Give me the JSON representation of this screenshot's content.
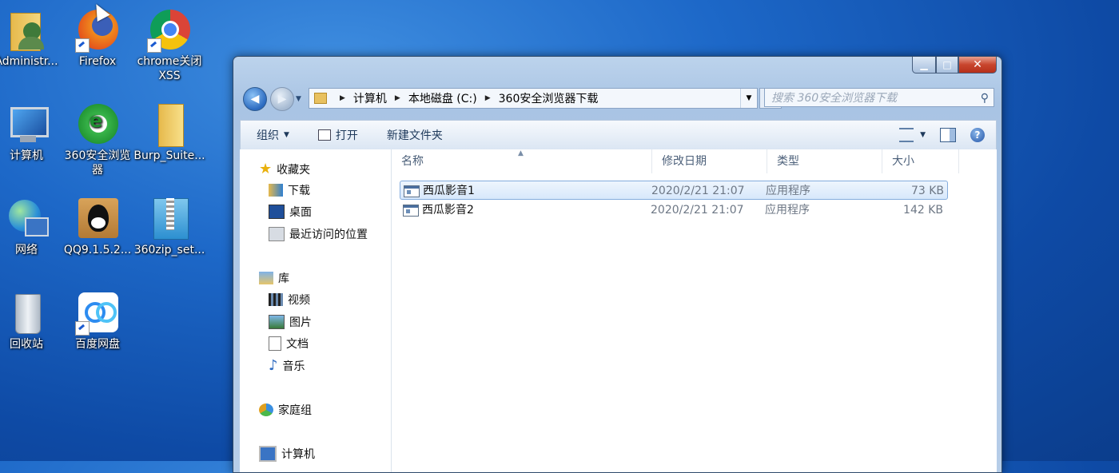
{
  "desktop": {
    "icons": [
      {
        "label": "Administr...",
        "icon": "user-folder-icon"
      },
      {
        "label": "Firefox",
        "icon": "firefox-icon"
      },
      {
        "label": "chrome关闭XSS",
        "icon": "chrome-icon"
      },
      {
        "label": "计算机",
        "icon": "computer-icon"
      },
      {
        "label": "360安全浏览器",
        "icon": "browser-360-icon"
      },
      {
        "label": "Burp_Suite...",
        "icon": "folder-icon"
      },
      {
        "label": "网络",
        "icon": "network-icon"
      },
      {
        "label": "QQ9.1.5.2...",
        "icon": "qq-icon"
      },
      {
        "label": "360zip_set...",
        "icon": "zip-installer-icon"
      },
      {
        "label": "回收站",
        "icon": "recycle-bin-icon"
      },
      {
        "label": "百度网盘",
        "icon": "baidu-netdisk-icon"
      }
    ]
  },
  "window": {
    "controls": {
      "minimize": "▁",
      "maximize": "□",
      "close": "✕"
    },
    "address": {
      "crumbs": [
        "计算机",
        "本地磁盘 (C:)",
        "360安全浏览器下载"
      ],
      "search_placeholder": "搜索 360安全浏览器下载"
    },
    "toolbar": {
      "organize": "组织",
      "open": "打开",
      "new_folder": "新建文件夹",
      "help": "?"
    },
    "nav": {
      "favorites": "收藏夹",
      "downloads": "下载",
      "desktop": "桌面",
      "recent": "最近访问的位置",
      "libraries": "库",
      "videos": "视频",
      "pictures": "图片",
      "documents": "文档",
      "music": "音乐",
      "homegroup": "家庭组",
      "computer": "计算机"
    },
    "columns": {
      "name": "名称",
      "date": "修改日期",
      "type": "类型",
      "size": "大小"
    },
    "files": [
      {
        "name": "西瓜影音1",
        "date": "2020/2/21 21:07",
        "type": "应用程序",
        "size": "73 KB"
      },
      {
        "name": "西瓜影音2",
        "date": "2020/2/21 21:07",
        "type": "应用程序",
        "size": "142 KB"
      }
    ]
  },
  "colors": {
    "accent": "#1d68c8",
    "selection": "#d7e8fb"
  }
}
